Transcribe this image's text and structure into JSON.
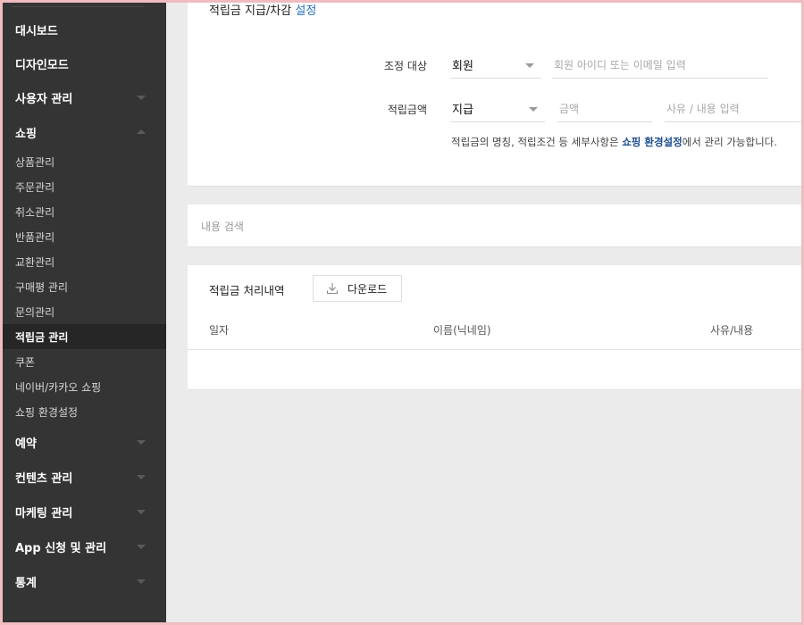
{
  "sidebar": {
    "groups": [
      {
        "label": "대시보드"
      },
      {
        "label": "디자인모드"
      },
      {
        "label": "사용자 관리"
      },
      {
        "label": "쇼핑"
      },
      {
        "label": "예약"
      },
      {
        "label": "컨텐츠 관리"
      },
      {
        "label": "마케팅 관리"
      },
      {
        "label": "App 신청 및 관리"
      },
      {
        "label": "통계"
      }
    ],
    "shop_items": [
      {
        "label": "상품관리"
      },
      {
        "label": "주문관리"
      },
      {
        "label": "취소관리"
      },
      {
        "label": "반품관리"
      },
      {
        "label": "교환관리"
      },
      {
        "label": "구매평 관리"
      },
      {
        "label": "문의관리"
      },
      {
        "label": "적립금 관리"
      },
      {
        "label": "쿠폰"
      },
      {
        "label": "네이버/카카오 쇼핑"
      },
      {
        "label": "쇼핑 환경설정"
      }
    ],
    "active_item": "적립금 관리"
  },
  "settings_card": {
    "title_prefix": "적립금 지급/차감",
    "title_link": "설정",
    "target_label": "조정 대상",
    "target_select": "회원",
    "member_placeholder": "회원 아이디 또는 이메일 입력",
    "amount_label": "적립금액",
    "amount_select": "지급",
    "amount_placeholder": "금액",
    "reason_placeholder": "사유 / 내용 입력",
    "help_prefix": "적립금의 명칭, 적립조건 등 세부사항은 ",
    "help_link": "쇼핑 환경설정",
    "help_suffix": "에서 관리 가능합니다."
  },
  "search_card": {
    "label": "내용 검색"
  },
  "history_card": {
    "title": "적립금 처리내역",
    "download_label": "다운로드",
    "columns": [
      "일자",
      "이름(닉네임)",
      "사유/내용"
    ]
  },
  "colors": {
    "sidebar_bg": "#343434",
    "active_item_bg": "#262626",
    "link": "#2a6fbd",
    "help_link": "#1d4e8f",
    "page_bg": "#ebebeb",
    "border_frame": "#efbcbf"
  }
}
